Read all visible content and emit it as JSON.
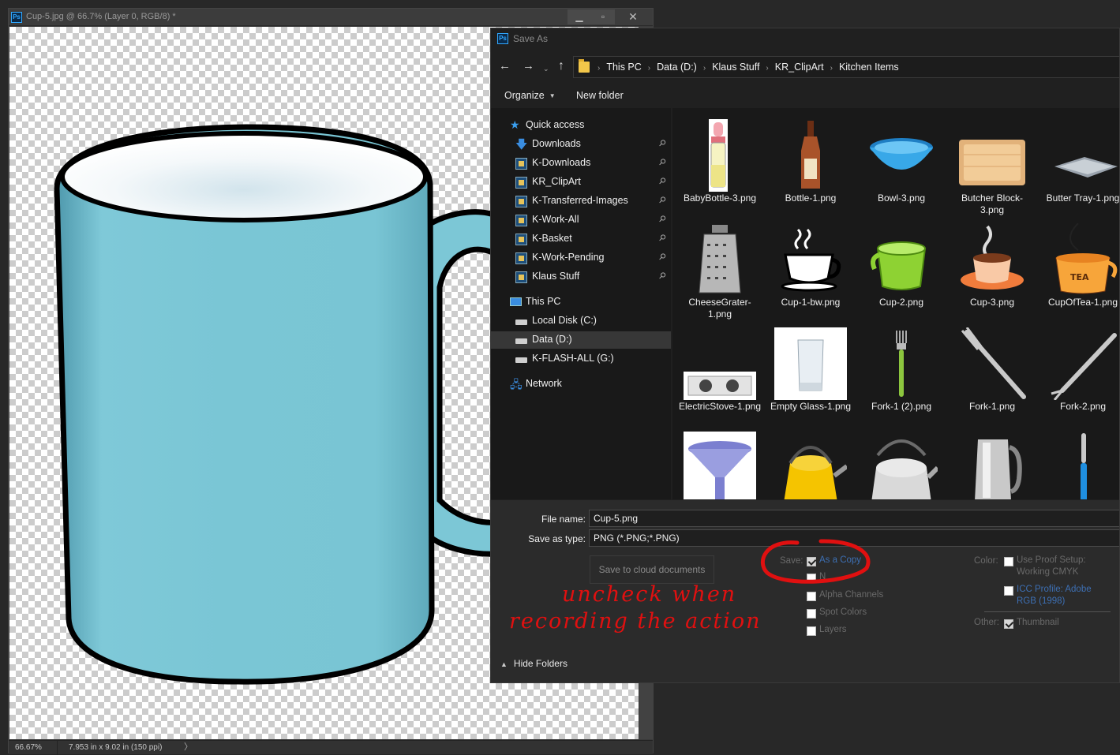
{
  "document": {
    "title": "Cup-5.jpg @ 66.7% (Layer 0, RGB/8) *",
    "app_badge": "Ps",
    "window_buttons": {
      "minimize": "▁",
      "maximize": "▫",
      "close": "✕"
    },
    "status": {
      "zoom": "66.67%",
      "info": "7.953 in x 9.02 in (150 ppi)",
      "arrow": "〉"
    }
  },
  "dialog": {
    "title": "Save As",
    "app_badge": "Ps",
    "nav": {
      "back": "←",
      "forward": "→",
      "recent": "⌄",
      "up": "↑"
    },
    "breadcrumb": [
      "This PC",
      "Data (D:)",
      "Klaus Stuff",
      "KR_ClipArt",
      "Kitchen Items"
    ],
    "breadcrumb_sep": "›",
    "toolbar": {
      "organize": "Organize",
      "organize_caret": "▼",
      "new_folder": "New folder"
    },
    "nav_pane": [
      {
        "label": "Quick access",
        "icon": "star-icon"
      },
      {
        "label": "Downloads",
        "icon": "download-arrow-icon",
        "pinned": true
      },
      {
        "label": "K-Downloads",
        "icon": "folder-thumbnail-icon",
        "pinned": true
      },
      {
        "label": "KR_ClipArt",
        "icon": "folder-thumbnail-icon",
        "pinned": true
      },
      {
        "label": "K-Transferred-Images",
        "icon": "folder-thumbnail-icon",
        "pinned": true
      },
      {
        "label": "K-Work-All",
        "icon": "folder-thumbnail-icon",
        "pinned": true
      },
      {
        "label": "K-Basket",
        "icon": "folder-thumbnail-icon",
        "pinned": true
      },
      {
        "label": "K-Work-Pending",
        "icon": "folder-thumbnail-icon",
        "pinned": true
      },
      {
        "label": "Klaus Stuff",
        "icon": "folder-thumbnail-icon",
        "pinned": true
      },
      {
        "label": "This PC",
        "icon": "computer-icon"
      },
      {
        "label": "Local Disk (C:)",
        "icon": "drive-icon"
      },
      {
        "label": "Data (D:)",
        "icon": "drive-icon",
        "selected": true
      },
      {
        "label": "K-FLASH-ALL (G:)",
        "icon": "drive-icon"
      },
      {
        "label": "Network",
        "icon": "network-icon"
      }
    ],
    "pin_glyph": "📌",
    "files": [
      {
        "name": "BabyBottle-3.png",
        "icon": "baby-bottle-icon"
      },
      {
        "name": "Bottle-1.png",
        "icon": "bottle-icon"
      },
      {
        "name": "Bowl-3.png",
        "icon": "bowl-icon"
      },
      {
        "name": "Butcher Block-3.png",
        "icon": "butcher-block-icon"
      },
      {
        "name": "Butter Tray-1.png",
        "icon": "butter-tray-icon"
      },
      {
        "name": "CheeseGrater-1.png",
        "icon": "cheese-grater-icon"
      },
      {
        "name": "Cup-1-bw.png",
        "icon": "cup-bw-icon"
      },
      {
        "name": "Cup-2.png",
        "icon": "green-cup-icon"
      },
      {
        "name": "Cup-3.png",
        "icon": "orange-cup-icon"
      },
      {
        "name": "CupOfTea-1.png",
        "icon": "tea-cup-icon"
      },
      {
        "name": "ElectricStove-1.png",
        "icon": "electric-stove-icon"
      },
      {
        "name": "Empty Glass-1.png",
        "icon": "glass-icon"
      },
      {
        "name": "Fork-1 (2).png",
        "icon": "green-fork-icon"
      },
      {
        "name": "Fork-1.png",
        "icon": "fork-icon"
      },
      {
        "name": "Fork-2.png",
        "icon": "fork-2-icon"
      },
      {
        "name": "",
        "icon": "funnel-icon"
      },
      {
        "name": "",
        "icon": "yellow-kettle-icon"
      },
      {
        "name": "",
        "icon": "steel-kettle-icon"
      },
      {
        "name": "",
        "icon": "electric-kettle-icon"
      },
      {
        "name": "",
        "icon": "knife-icon"
      }
    ],
    "file_name_label": "File name:",
    "file_name_value": "Cup-5.png",
    "save_type_label": "Save as type:",
    "save_type_value": "PNG (*.PNG;*.PNG)",
    "cloud_button": "Save to cloud documents",
    "save_label": "Save:",
    "save_options": [
      {
        "label": "As a Copy",
        "checked": true
      },
      {
        "label": "Alpha Channels",
        "checked": false
      },
      {
        "label": "Spot Colors",
        "checked": false
      },
      {
        "label": "Layers",
        "checked": false
      }
    ],
    "partial_option_text": "N",
    "color_label": "Color:",
    "color_options": [
      {
        "label": "Use Proof Setup: Working CMYK",
        "line1": "Use Proof Setup:",
        "line2": "Working CMYK",
        "checked": false
      },
      {
        "label": "ICC Profile: Adobe RGB (1998)",
        "line1": "ICC Profile:  Adobe",
        "line2": "RGB (1998)",
        "checked": false
      }
    ],
    "other_label": "Other:",
    "thumbnail_label": "Thumbnail",
    "hide_folders": "Hide Folders",
    "hide_caret": "▲"
  },
  "annotation": {
    "line1": "uncheck when",
    "line2": "recording the action",
    "color": "#e01010"
  },
  "colors": {
    "cup": "#7cc7d6",
    "accent": "#31a8ff",
    "link_blue": "#3d6fb3"
  }
}
